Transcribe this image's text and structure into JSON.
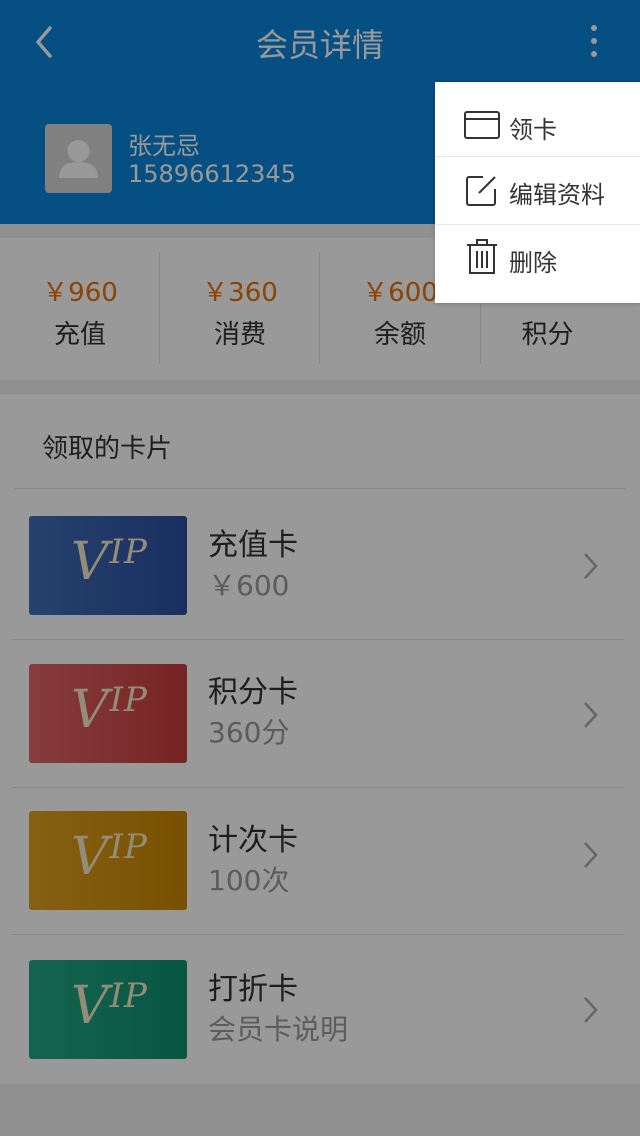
{
  "header": {
    "title": "会员详情"
  },
  "member": {
    "name": "张无忌",
    "phone": "15896612345"
  },
  "stats": [
    {
      "value": "￥960",
      "label": "充值"
    },
    {
      "value": "￥360",
      "label": "消费"
    },
    {
      "value": "￥600",
      "label": "余额"
    },
    {
      "value": "",
      "label": "积分"
    }
  ],
  "cards_section": {
    "title": "领取的卡片",
    "cards": [
      {
        "logo": "V",
        "logo_sup": "IP",
        "name": "充值卡",
        "desc": "￥600",
        "color_start": "#3f6fb8",
        "color_end": "#2b4ea0"
      },
      {
        "logo": "V",
        "logo_sup": "IP",
        "name": "积分卡",
        "desc": "360分",
        "color_start": "#e06666",
        "color_end": "#c83a3a"
      },
      {
        "logo": "V",
        "logo_sup": "IP",
        "name": "计次卡",
        "desc": "100次",
        "color_start": "#e0a020",
        "color_end": "#c98600"
      },
      {
        "logo": "V",
        "logo_sup": "IP",
        "name": "打折卡",
        "desc": "会员卡说明",
        "color_start": "#22a886",
        "color_end": "#0f8f6d"
      }
    ]
  },
  "menu": {
    "items": [
      {
        "label": "领卡",
        "icon": "card-icon"
      },
      {
        "label": "编辑资料",
        "icon": "edit-icon"
      },
      {
        "label": "删除",
        "icon": "trash-icon"
      }
    ]
  },
  "colors": {
    "brand": "#0b84d9",
    "accent": "#e8700a"
  }
}
